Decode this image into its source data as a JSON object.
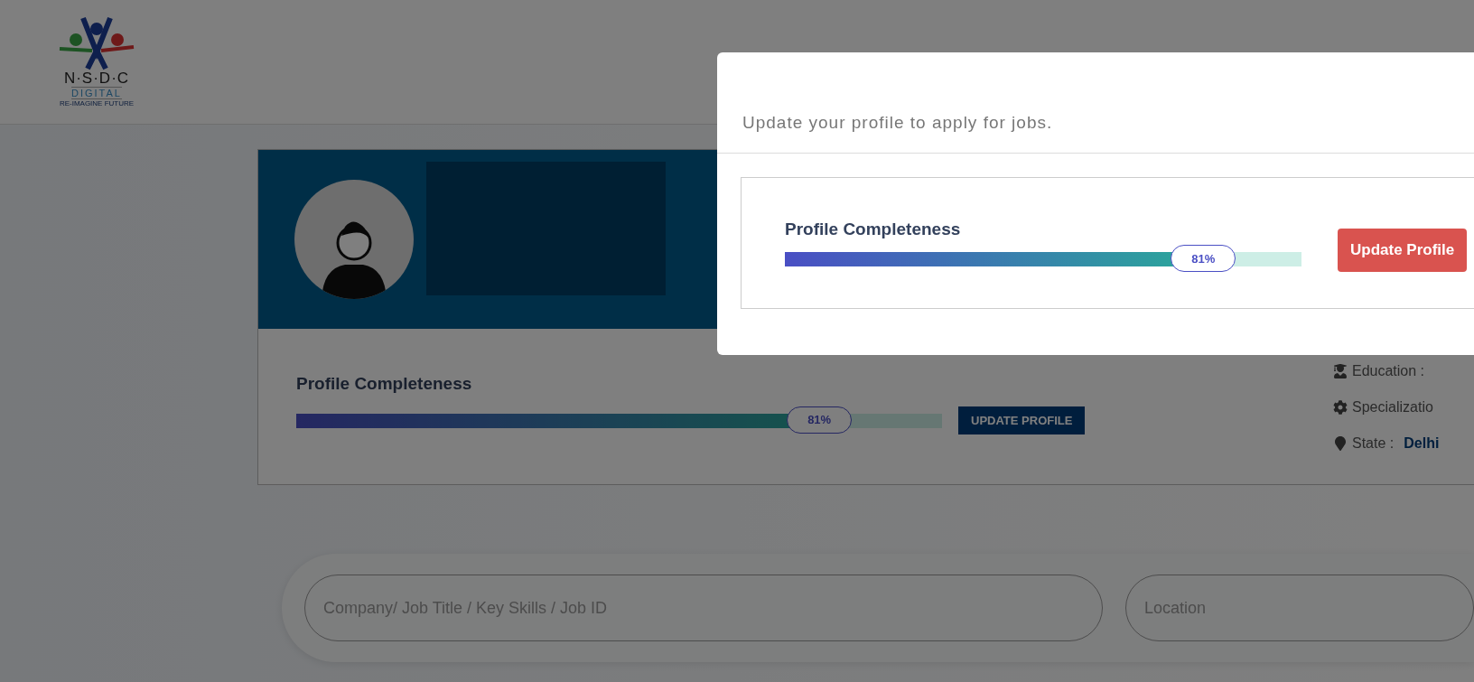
{
  "logo": {
    "letters": "N·S·D·C",
    "sub": "DIGITAL",
    "tagline": "RE-IMAGINE FUTURE"
  },
  "profile": {
    "completeness_label": "Profile Completeness",
    "level": 0.81,
    "percent": "81%",
    "button": "UPDATE PROFILE",
    "details": [
      {
        "kind": "education",
        "label": "Education :"
      },
      {
        "kind": "specialization",
        "label": "Specializatio"
      },
      {
        "kind": "state",
        "label": "State :",
        "value": "Delhi"
      }
    ]
  },
  "search": {
    "keyword_placeholder": "Company/ Job Title / Key Skills / Job ID",
    "location_placeholder": "Location"
  },
  "modal": {
    "message": "Update your profile to apply for jobs.",
    "completeness_label": "Profile Completeness",
    "level": 0.81,
    "percent": "81%",
    "button": "Update Profile"
  }
}
